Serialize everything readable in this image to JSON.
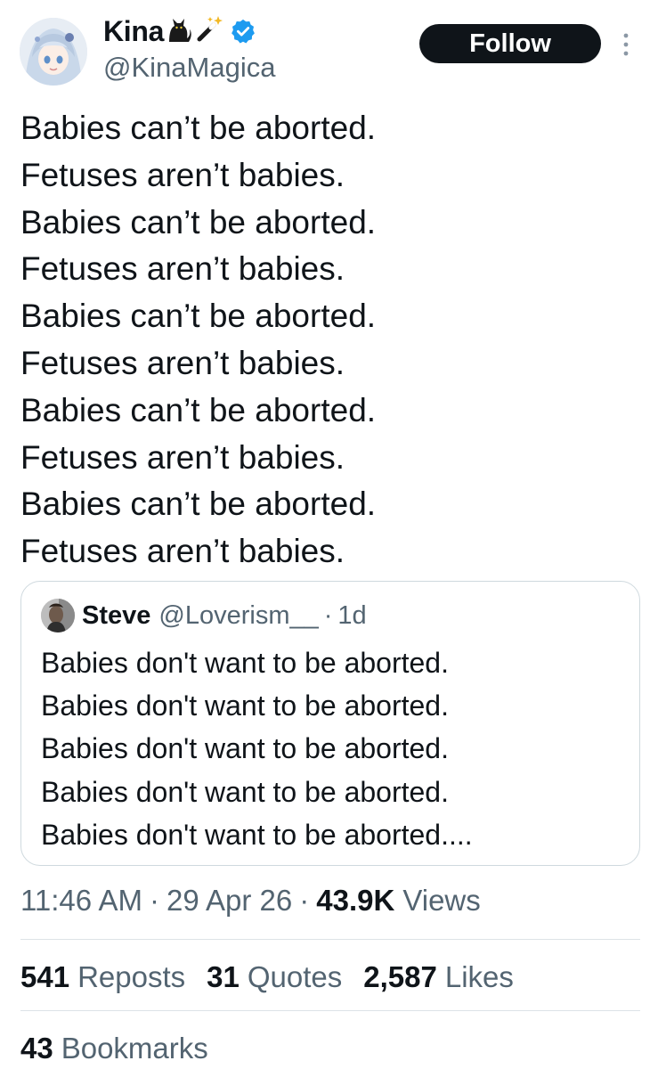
{
  "author": {
    "display_name": "Kina",
    "handle": "@KinaMagica",
    "name_emojis": [
      "black-cat-emoji",
      "magic-wand-emoji"
    ],
    "verified": true
  },
  "follow_button": {
    "label": "Follow"
  },
  "tweet": {
    "lines": [
      "Babies can’t be aborted.",
      "Fetuses aren’t babies.",
      "Babies can’t be aborted.",
      "Fetuses aren’t babies.",
      "Babies can’t be aborted.",
      "Fetuses aren’t babies.",
      "Babies can’t be aborted.",
      "Fetuses aren’t babies.",
      "Babies can’t be aborted.",
      "Fetuses aren’t babies."
    ]
  },
  "quote": {
    "name": "Steve",
    "handle": "@Loverism__",
    "dot": "·",
    "time": "1d",
    "lines": [
      "Babies don't want to be aborted.",
      "Babies don't want to be aborted.",
      "Babies don't want to be aborted.",
      "Babies don't want to be aborted.",
      "Babies don't want to be aborted...."
    ]
  },
  "meta": {
    "time": "11:46 AM",
    "sep": "·",
    "date": "29 Apr 26",
    "views_count": "43.9K",
    "views_label": "Views"
  },
  "stats": {
    "reposts_count": "541",
    "reposts_label": "Reposts",
    "quotes_count": "31",
    "quotes_label": "Quotes",
    "likes_count": "2,587",
    "likes_label": "Likes",
    "bookmarks_count": "43",
    "bookmarks_label": "Bookmarks"
  },
  "colors": {
    "text_primary": "#0f1419",
    "text_secondary": "#536471",
    "verified_blue": "#1d9bf0",
    "border": "#cfd9de"
  }
}
